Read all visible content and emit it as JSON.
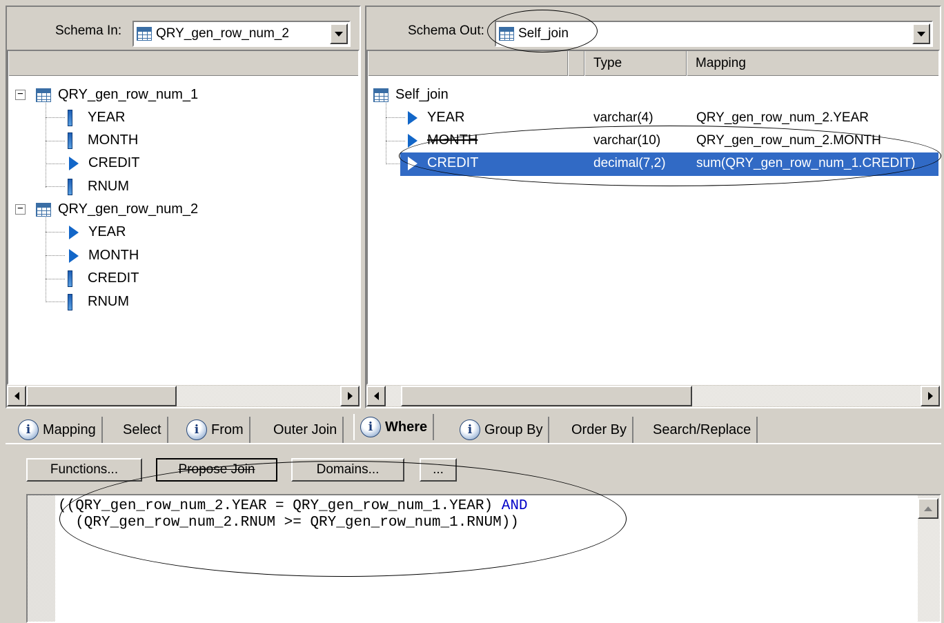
{
  "schema_in": {
    "label": "Schema In:",
    "value": "QRY_gen_row_num_2"
  },
  "schema_out": {
    "label": "Schema Out:",
    "value": "Self_join"
  },
  "left_tree": {
    "tables": [
      {
        "name": "QRY_gen_row_num_1",
        "columns": [
          {
            "name": "YEAR",
            "icon": "column-icon"
          },
          {
            "name": "MONTH",
            "icon": "column-icon"
          },
          {
            "name": "CREDIT",
            "icon": "mapped-arrow-icon"
          },
          {
            "name": "RNUM",
            "icon": "column-icon"
          }
        ]
      },
      {
        "name": "QRY_gen_row_num_2",
        "columns": [
          {
            "name": "YEAR",
            "icon": "mapped-arrow-icon"
          },
          {
            "name": "MONTH",
            "icon": "mapped-arrow-icon"
          },
          {
            "name": "CREDIT",
            "icon": "column-icon"
          },
          {
            "name": "RNUM",
            "icon": "column-icon"
          }
        ]
      }
    ]
  },
  "right_tree": {
    "headers": {
      "type": "Type",
      "mapping": "Mapping"
    },
    "root": "Self_join",
    "rows": [
      {
        "name": "YEAR",
        "type": "varchar(4)",
        "mapping": "QRY_gen_row_num_2.YEAR"
      },
      {
        "name": "MONTH",
        "type": "varchar(10)",
        "mapping": "QRY_gen_row_num_2.MONTH"
      },
      {
        "name": "CREDIT",
        "type": "decimal(7,2)",
        "mapping": "sum(QRY_gen_row_num_1.CREDIT)",
        "selected": true
      }
    ]
  },
  "tabs": {
    "mapping": "Mapping",
    "select": "Select",
    "from": "From",
    "outer_join": "Outer Join",
    "where": "Where",
    "group_by": "Group By",
    "order_by": "Order By",
    "search_replace": "Search/Replace"
  },
  "buttons": {
    "functions": "Functions...",
    "propose_join": "Propose Join",
    "domains": "Domains...",
    "more": "..."
  },
  "editor": {
    "line1_prefix": "((QRY_gen_row_num_2.YEAR = QRY_gen_row_num_1.YEAR) ",
    "line1_keyword": "AND",
    "line2": "  (QRY_gen_row_num_2.RNUM >= QRY_gen_row_num_1.RNUM))"
  },
  "colors": {
    "selection": "#316ac5",
    "keyword": "#0000c8",
    "background": "#d4d0c8"
  }
}
